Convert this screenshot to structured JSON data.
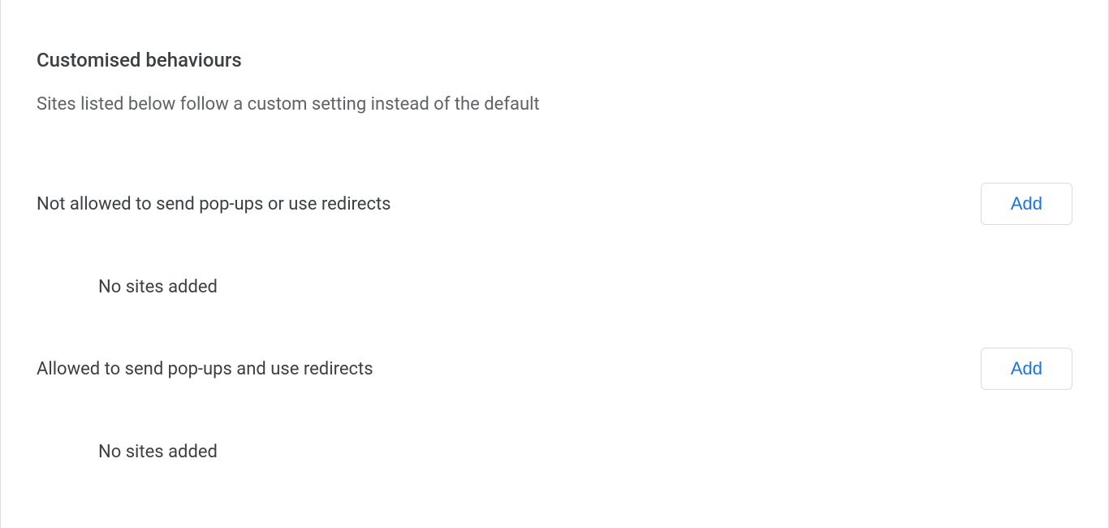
{
  "section": {
    "title": "Customised behaviours",
    "subtitle": "Sites listed below follow a custom setting instead of the default"
  },
  "groups": [
    {
      "label": "Not allowed to send pop-ups or use redirects",
      "add_label": "Add",
      "empty_text": "No sites added"
    },
    {
      "label": "Allowed to send pop-ups and use redirects",
      "add_label": "Add",
      "empty_text": "No sites added"
    }
  ]
}
